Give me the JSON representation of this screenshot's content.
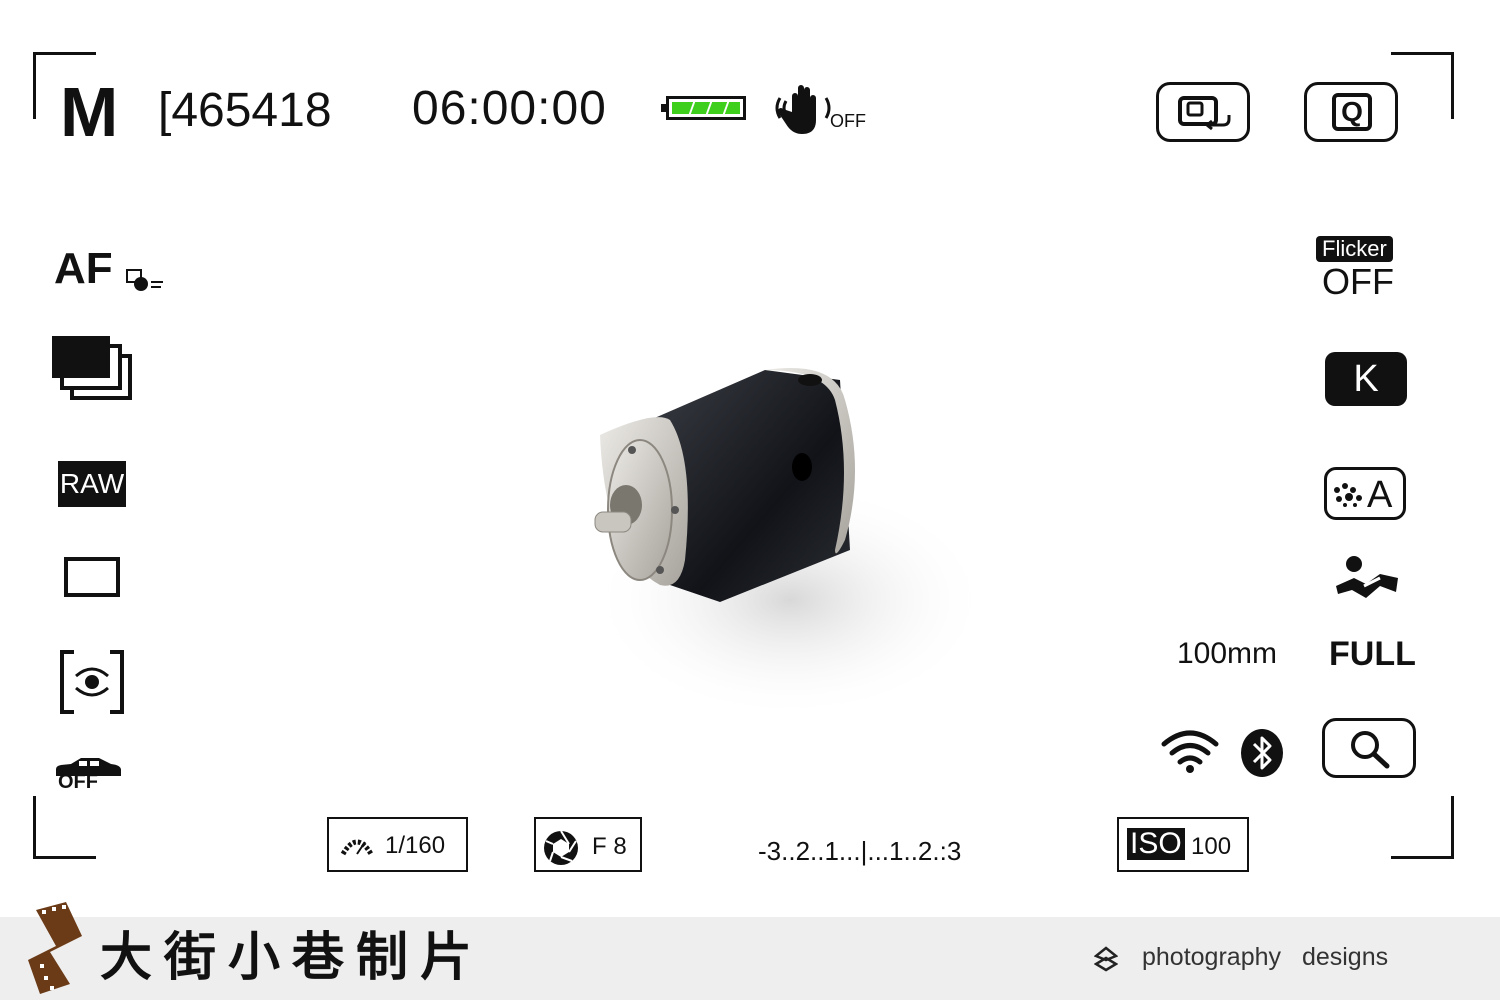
{
  "header": {
    "mode": "M",
    "shots_remaining": "[465418",
    "timecode": "06:00:00",
    "battery_level": 1.0,
    "battery_color": "#3ecf1c",
    "stabilizer_label": "OFF",
    "stabilizer_icon": "hand-shake-icon",
    "display_button_icon": "display-rotate-icon",
    "quick_menu_icon": "q-icon",
    "quick_menu_label": "Q"
  },
  "left_column": {
    "af_label": "AF",
    "af_icon": "af-continuous-icon",
    "drive_icon": "continuous-drive-icon",
    "format_label": "RAW",
    "aspect_icon": "aspect-ratio-icon",
    "metering_icon": "metering-icon",
    "vehicle_detect_label": "OFF",
    "vehicle_detect_icon": "car-detect-icon"
  },
  "right_column": {
    "flicker_label": "Flicker",
    "flicker_value": "OFF",
    "wb_label": "K",
    "scene_label": "A",
    "scene_icon": "scene-auto-icon",
    "body_icon": "body-detect-icon",
    "focal_length": "100mm",
    "frame_mode": "FULL",
    "wifi_icon": "wifi-icon",
    "bluetooth_icon": "bluetooth-icon",
    "zoom_icon": "magnify-icon"
  },
  "status_bar": {
    "shutter_speed": "1/160",
    "aperture": "F 8",
    "exposure_scale": "-3..2..1...|...1..2.:3",
    "iso_label": "ISO",
    "iso_value": "100"
  },
  "footer": {
    "brand": "大街小巷制片",
    "tagline": "photography designs",
    "brand_icon": "film-strip-icon",
    "tagline_icon": "diamond-logo-icon"
  }
}
